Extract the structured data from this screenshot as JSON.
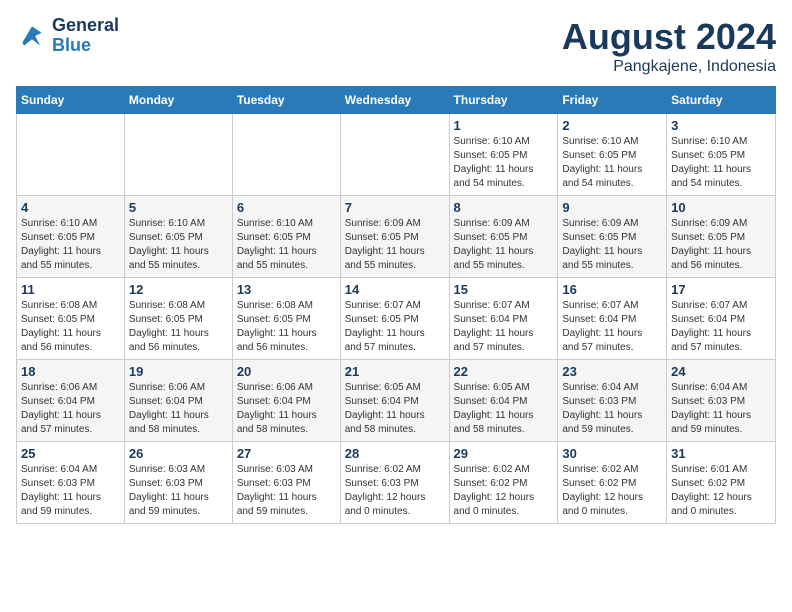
{
  "logo": {
    "line1": "General",
    "line2": "Blue"
  },
  "title": "August 2024",
  "subtitle": "Pangkajene, Indonesia",
  "days_of_week": [
    "Sunday",
    "Monday",
    "Tuesday",
    "Wednesday",
    "Thursday",
    "Friday",
    "Saturday"
  ],
  "weeks": [
    [
      {
        "day": "",
        "info": ""
      },
      {
        "day": "",
        "info": ""
      },
      {
        "day": "",
        "info": ""
      },
      {
        "day": "",
        "info": ""
      },
      {
        "day": "1",
        "info": "Sunrise: 6:10 AM\nSunset: 6:05 PM\nDaylight: 11 hours\nand 54 minutes."
      },
      {
        "day": "2",
        "info": "Sunrise: 6:10 AM\nSunset: 6:05 PM\nDaylight: 11 hours\nand 54 minutes."
      },
      {
        "day": "3",
        "info": "Sunrise: 6:10 AM\nSunset: 6:05 PM\nDaylight: 11 hours\nand 54 minutes."
      }
    ],
    [
      {
        "day": "4",
        "info": "Sunrise: 6:10 AM\nSunset: 6:05 PM\nDaylight: 11 hours\nand 55 minutes."
      },
      {
        "day": "5",
        "info": "Sunrise: 6:10 AM\nSunset: 6:05 PM\nDaylight: 11 hours\nand 55 minutes."
      },
      {
        "day": "6",
        "info": "Sunrise: 6:10 AM\nSunset: 6:05 PM\nDaylight: 11 hours\nand 55 minutes."
      },
      {
        "day": "7",
        "info": "Sunrise: 6:09 AM\nSunset: 6:05 PM\nDaylight: 11 hours\nand 55 minutes."
      },
      {
        "day": "8",
        "info": "Sunrise: 6:09 AM\nSunset: 6:05 PM\nDaylight: 11 hours\nand 55 minutes."
      },
      {
        "day": "9",
        "info": "Sunrise: 6:09 AM\nSunset: 6:05 PM\nDaylight: 11 hours\nand 55 minutes."
      },
      {
        "day": "10",
        "info": "Sunrise: 6:09 AM\nSunset: 6:05 PM\nDaylight: 11 hours\nand 56 minutes."
      }
    ],
    [
      {
        "day": "11",
        "info": "Sunrise: 6:08 AM\nSunset: 6:05 PM\nDaylight: 11 hours\nand 56 minutes."
      },
      {
        "day": "12",
        "info": "Sunrise: 6:08 AM\nSunset: 6:05 PM\nDaylight: 11 hours\nand 56 minutes."
      },
      {
        "day": "13",
        "info": "Sunrise: 6:08 AM\nSunset: 6:05 PM\nDaylight: 11 hours\nand 56 minutes."
      },
      {
        "day": "14",
        "info": "Sunrise: 6:07 AM\nSunset: 6:05 PM\nDaylight: 11 hours\nand 57 minutes."
      },
      {
        "day": "15",
        "info": "Sunrise: 6:07 AM\nSunset: 6:04 PM\nDaylight: 11 hours\nand 57 minutes."
      },
      {
        "day": "16",
        "info": "Sunrise: 6:07 AM\nSunset: 6:04 PM\nDaylight: 11 hours\nand 57 minutes."
      },
      {
        "day": "17",
        "info": "Sunrise: 6:07 AM\nSunset: 6:04 PM\nDaylight: 11 hours\nand 57 minutes."
      }
    ],
    [
      {
        "day": "18",
        "info": "Sunrise: 6:06 AM\nSunset: 6:04 PM\nDaylight: 11 hours\nand 57 minutes."
      },
      {
        "day": "19",
        "info": "Sunrise: 6:06 AM\nSunset: 6:04 PM\nDaylight: 11 hours\nand 58 minutes."
      },
      {
        "day": "20",
        "info": "Sunrise: 6:06 AM\nSunset: 6:04 PM\nDaylight: 11 hours\nand 58 minutes."
      },
      {
        "day": "21",
        "info": "Sunrise: 6:05 AM\nSunset: 6:04 PM\nDaylight: 11 hours\nand 58 minutes."
      },
      {
        "day": "22",
        "info": "Sunrise: 6:05 AM\nSunset: 6:04 PM\nDaylight: 11 hours\nand 58 minutes."
      },
      {
        "day": "23",
        "info": "Sunrise: 6:04 AM\nSunset: 6:03 PM\nDaylight: 11 hours\nand 59 minutes."
      },
      {
        "day": "24",
        "info": "Sunrise: 6:04 AM\nSunset: 6:03 PM\nDaylight: 11 hours\nand 59 minutes."
      }
    ],
    [
      {
        "day": "25",
        "info": "Sunrise: 6:04 AM\nSunset: 6:03 PM\nDaylight: 11 hours\nand 59 minutes."
      },
      {
        "day": "26",
        "info": "Sunrise: 6:03 AM\nSunset: 6:03 PM\nDaylight: 11 hours\nand 59 minutes."
      },
      {
        "day": "27",
        "info": "Sunrise: 6:03 AM\nSunset: 6:03 PM\nDaylight: 11 hours\nand 59 minutes."
      },
      {
        "day": "28",
        "info": "Sunrise: 6:02 AM\nSunset: 6:03 PM\nDaylight: 12 hours\nand 0 minutes."
      },
      {
        "day": "29",
        "info": "Sunrise: 6:02 AM\nSunset: 6:02 PM\nDaylight: 12 hours\nand 0 minutes."
      },
      {
        "day": "30",
        "info": "Sunrise: 6:02 AM\nSunset: 6:02 PM\nDaylight: 12 hours\nand 0 minutes."
      },
      {
        "day": "31",
        "info": "Sunrise: 6:01 AM\nSunset: 6:02 PM\nDaylight: 12 hours\nand 0 minutes."
      }
    ]
  ]
}
